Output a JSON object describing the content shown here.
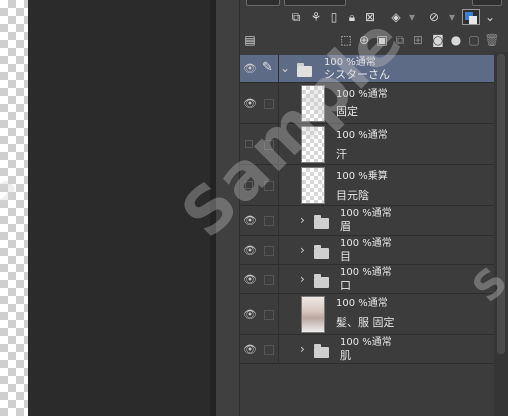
{
  "panel": {
    "mode_tab_label": "通常",
    "opacity_tab_label": "100"
  },
  "toolbar_row1": {
    "icons": [
      "new-raster-layer-icon",
      "transfer-icon",
      "lock-icon",
      "lock-transparent-icon",
      "mask-icon",
      "reference-icon",
      "color-swatch-icon"
    ]
  },
  "toolbar_row2": {
    "icons": [
      "layer-property-icon",
      "new-layer-icon",
      "new-vector-icon",
      "new-folder-icon",
      "duplicate-icon",
      "merge-icon",
      "mask-add-icon",
      "mask-apply-icon",
      "trash-icon"
    ]
  },
  "layers": [
    {
      "mode": "100 %通常",
      "name": "シスターさん",
      "type": "folder",
      "expanded": true,
      "visible": true,
      "selected": true,
      "editing": true
    },
    {
      "mode": "100 %通常",
      "name": "固定",
      "type": "raster",
      "visible": true
    },
    {
      "mode": "100 %通常",
      "name": "汗",
      "type": "raster",
      "visible": false
    },
    {
      "mode": "100 %乗算",
      "name": "目元陰",
      "type": "raster",
      "visible": false
    },
    {
      "mode": "100 %通常",
      "name": "眉",
      "type": "folder",
      "expanded": false,
      "visible": true
    },
    {
      "mode": "100 %通常",
      "name": "目",
      "type": "folder",
      "expanded": false,
      "visible": true
    },
    {
      "mode": "100 %通常",
      "name": "口",
      "type": "folder",
      "expanded": false,
      "visible": true
    },
    {
      "mode": "100 %通常",
      "name": "髪、服  固定",
      "type": "raster-photo",
      "visible": true
    },
    {
      "mode": "100 %通常",
      "name": "肌",
      "type": "folder",
      "expanded": false,
      "visible": true
    }
  ],
  "watermark": "Sample",
  "colors": {
    "selected_row": "#5e6b86",
    "accent_blue": "#3a7fd8",
    "panel_bg": "#3c3c3c"
  }
}
